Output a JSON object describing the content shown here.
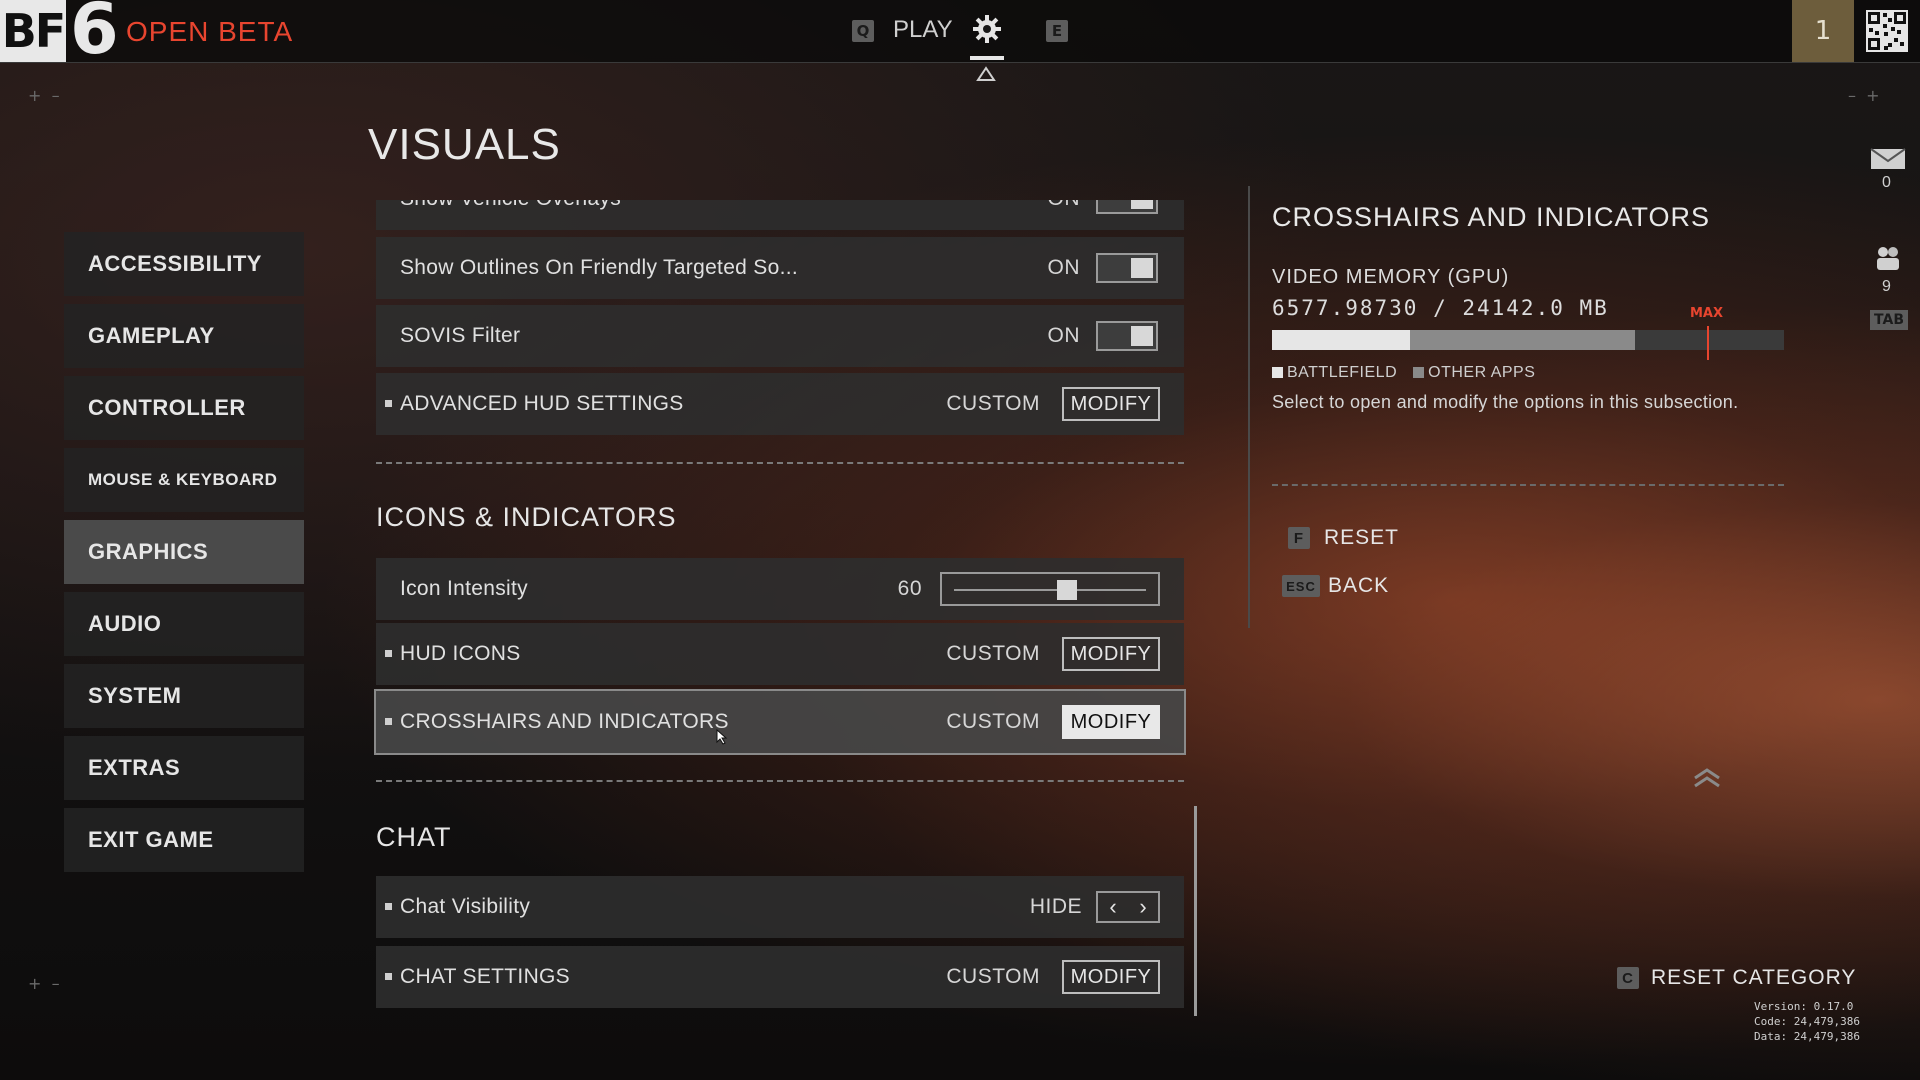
{
  "header": {
    "logo_bf": "BF",
    "logo_num": "6",
    "beta_label": "OPEN BETA",
    "left_key": "Q",
    "play_label": "PLAY",
    "right_key": "E",
    "rank": "1"
  },
  "page_title": "VISUALS",
  "sidebar": {
    "items": [
      {
        "label": "ACCESSIBILITY"
      },
      {
        "label": "GAMEPLAY"
      },
      {
        "label": "CONTROLLER"
      },
      {
        "label": "MOUSE & KEYBOARD"
      },
      {
        "label": "GRAPHICS",
        "active": true
      },
      {
        "label": "AUDIO"
      },
      {
        "label": "SYSTEM"
      },
      {
        "label": "EXTRAS"
      },
      {
        "label": "EXIT GAME"
      }
    ]
  },
  "rows": {
    "vehicle_overlays": {
      "label": "Show Vehicle Overlays",
      "value": "ON"
    },
    "outlines": {
      "label": "Show Outlines On Friendly Targeted So...",
      "value": "ON"
    },
    "sovis": {
      "label": "SOVIS Filter",
      "value": "ON"
    },
    "advanced_hud": {
      "label": "ADVANCED HUD SETTINGS",
      "value": "CUSTOM",
      "button": "MODIFY"
    },
    "icon_intensity": {
      "label": "Icon Intensity",
      "value": "60",
      "level": 60
    },
    "hud_icons": {
      "label": "HUD ICONS",
      "value": "CUSTOM",
      "button": "MODIFY"
    },
    "crosshairs": {
      "label": "CROSSHAIRS AND INDICATORS",
      "value": "CUSTOM",
      "button": "MODIFY"
    },
    "chat_visibility": {
      "label": "Chat Visibility",
      "value": "HIDE",
      "prev": "‹",
      "next": "›"
    },
    "chat_settings": {
      "label": "CHAT SETTINGS",
      "value": "CUSTOM",
      "button": "MODIFY"
    }
  },
  "sections": {
    "icons": "ICONS & INDICATORS",
    "chat": "CHAT"
  },
  "panel": {
    "title": "CROSSHAIRS AND INDICATORS",
    "vm_label": "VIDEO MEMORY (GPU)",
    "vm_value": "6577.98730 / 24142.0 MB",
    "max_label": "MAX",
    "battlefield_share": 0.27,
    "other_share": 0.44,
    "max_mark": 0.85,
    "legend_bf": "BATTLEFIELD",
    "legend_other": "OTHER APPS",
    "description": "Select to open and modify the options in this subsection.",
    "reset_key": "F",
    "reset_label": "RESET",
    "back_key": "ESC",
    "back_label": "BACK"
  },
  "right_edge": {
    "mail_count": "0",
    "squad_count": "9",
    "tab_key": "TAB"
  },
  "footer": {
    "reset_key": "C",
    "reset_category": "RESET CATEGORY",
    "version": "Version: 0.17.0",
    "code": "Code: 24,479,386",
    "data": "Data: 24,479,386"
  },
  "colors": {
    "accent": "#e8452f",
    "rank_bg": "#6d5d3c"
  }
}
